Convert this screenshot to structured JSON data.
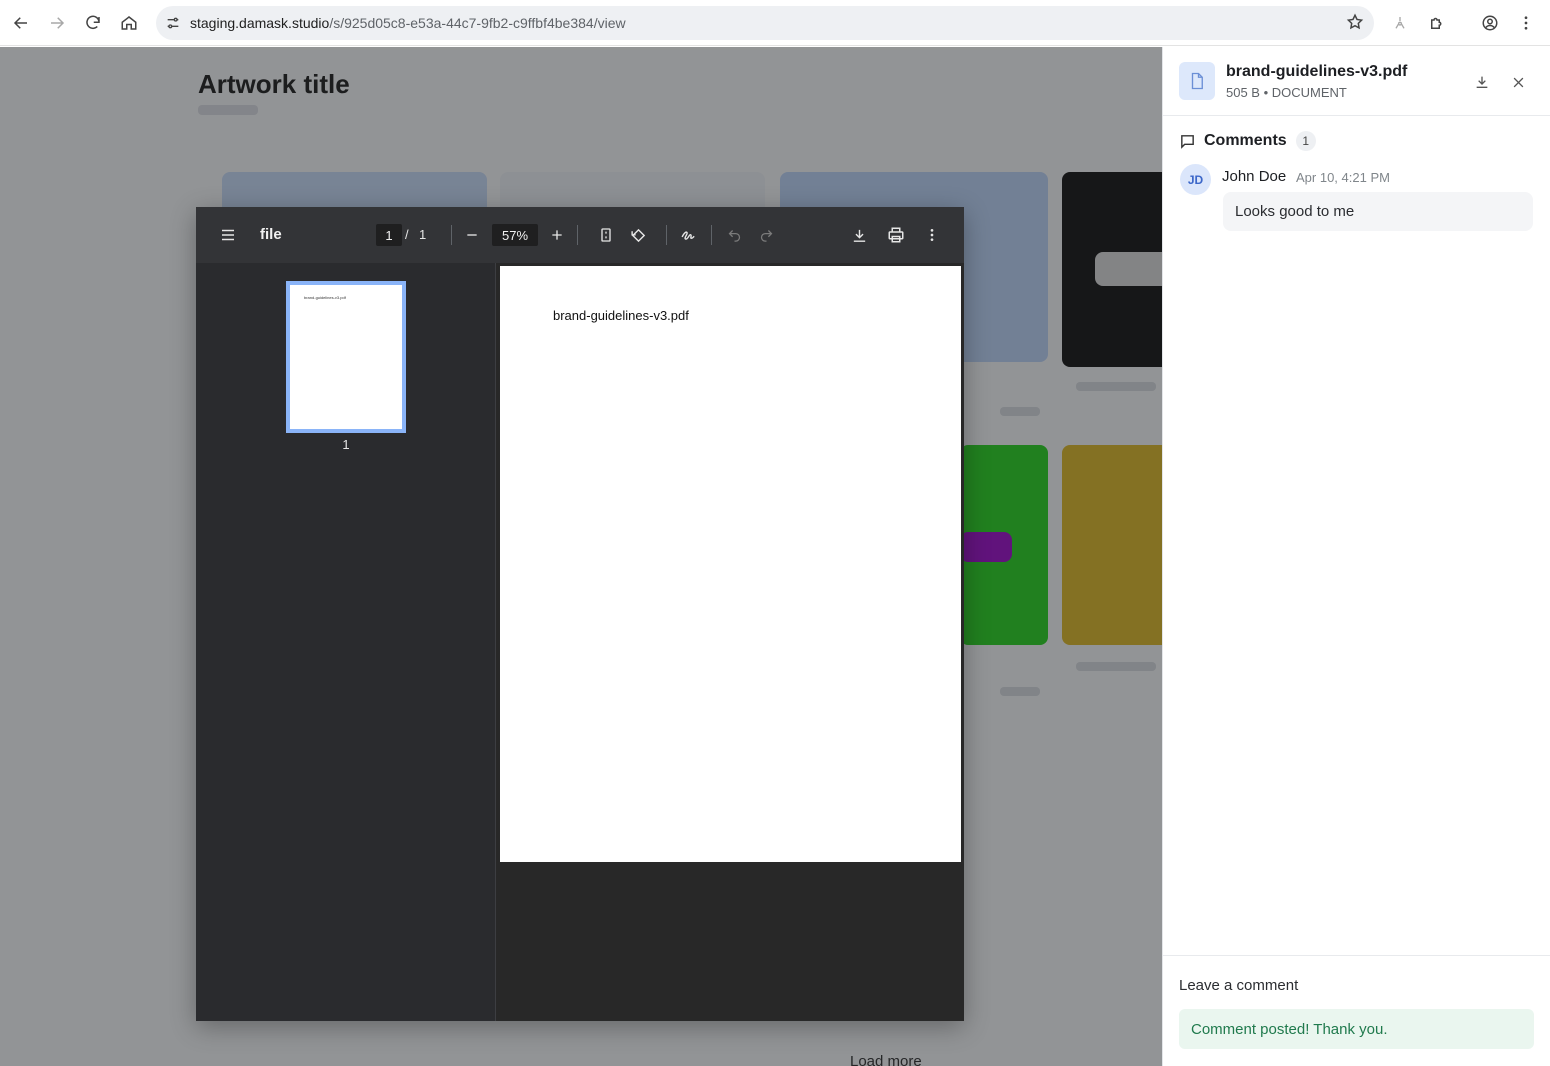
{
  "browser": {
    "url_host": "staging.damask.studio",
    "url_path": "/s/925d05c8-e53a-44c7-9fb2-c9ffbf4be384/view"
  },
  "background": {
    "title": "Artwork title",
    "footer_text": "Load more"
  },
  "pdf_viewer": {
    "filename": "file",
    "current_page": "1",
    "page_separator": "/",
    "total_pages": "1",
    "zoom": "57%",
    "page_content_text": "brand-guidelines-v3.pdf",
    "thumbnail_label": "1",
    "thumbnail_text": "brand-guidelines-v3.pdf"
  },
  "panel": {
    "file_name": "brand-guidelines-v3.pdf",
    "file_meta": "505 B • DOCUMENT",
    "comments_title": "Comments",
    "comments_count": "1",
    "comments": [
      {
        "initials": "JD",
        "author": "John Doe",
        "time": "Apr 10, 4:21 PM",
        "text": "Looks good to me"
      }
    ],
    "leave_comment_label": "Leave a comment",
    "posted_message": "Comment posted! Thank you."
  },
  "colors": {
    "success_bg": "#eaf6ef",
    "success_text": "#207a4d",
    "accent": "#8ab4f8"
  }
}
